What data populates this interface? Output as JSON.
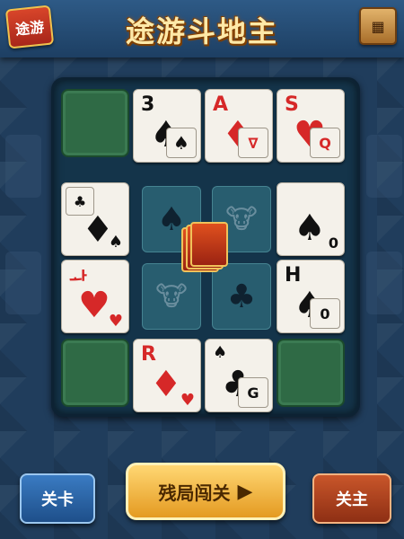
{
  "header": {
    "logo": "途游",
    "title": "途游斗地主",
    "menu_icon": "grid-menu-icon"
  },
  "board": {
    "cards": [
      {
        "rank": "3",
        "suit": "♠",
        "corner": "♠",
        "color": "black"
      },
      {
        "rank": "A",
        "suit": "♦",
        "corner": "∇",
        "color": "red"
      },
      {
        "rank": "S",
        "suit": "♥",
        "corner": "Q",
        "color": "red"
      },
      {
        "rank": "♣",
        "suit": "♦",
        "corner": "♠",
        "color": "black"
      },
      {
        "rank": "",
        "suit": "♠",
        "corner": "0",
        "color": "black"
      },
      {
        "rank": "ᅪ",
        "suit": "♥",
        "corner": "♥",
        "color": "red"
      },
      {
        "rank": "H",
        "suit": "♠",
        "corner": "0",
        "color": "black"
      },
      {
        "rank": "R",
        "suit": "♦",
        "corner": "♥",
        "color": "red"
      },
      {
        "rank": "♠",
        "suit": "♣",
        "corner": "G",
        "color": "black"
      }
    ],
    "center_slots": [
      "♠",
      "🐮",
      "🐮",
      "♣"
    ]
  },
  "buttons": {
    "level": "关卡",
    "endgame": "残局闯关",
    "boss": "关主"
  }
}
